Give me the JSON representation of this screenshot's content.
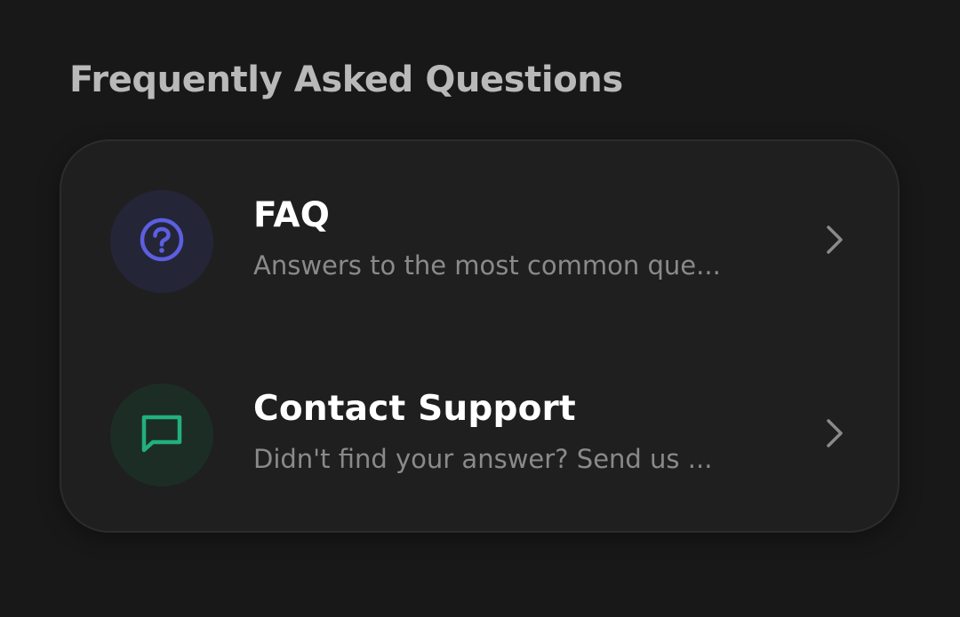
{
  "section": {
    "title": "Frequently Asked Questions"
  },
  "items": [
    {
      "title": "FAQ",
      "subtitle": "Answers to the most common que...",
      "icon": "question-circle-icon",
      "accent": "#5b5fe0",
      "icon_bg": "#252538"
    },
    {
      "title": "Contact Support",
      "subtitle": "Didn't find your answer? Send us ...",
      "icon": "message-square-icon",
      "accent": "#22b07d",
      "icon_bg": "#1c2d26"
    }
  ],
  "colors": {
    "background": "#181818",
    "card": "#1f1f1f",
    "title_text": "#b9b9b9",
    "item_title": "#ffffff",
    "item_subtitle": "#8a8a8a",
    "chevron": "#8a8a8a"
  }
}
